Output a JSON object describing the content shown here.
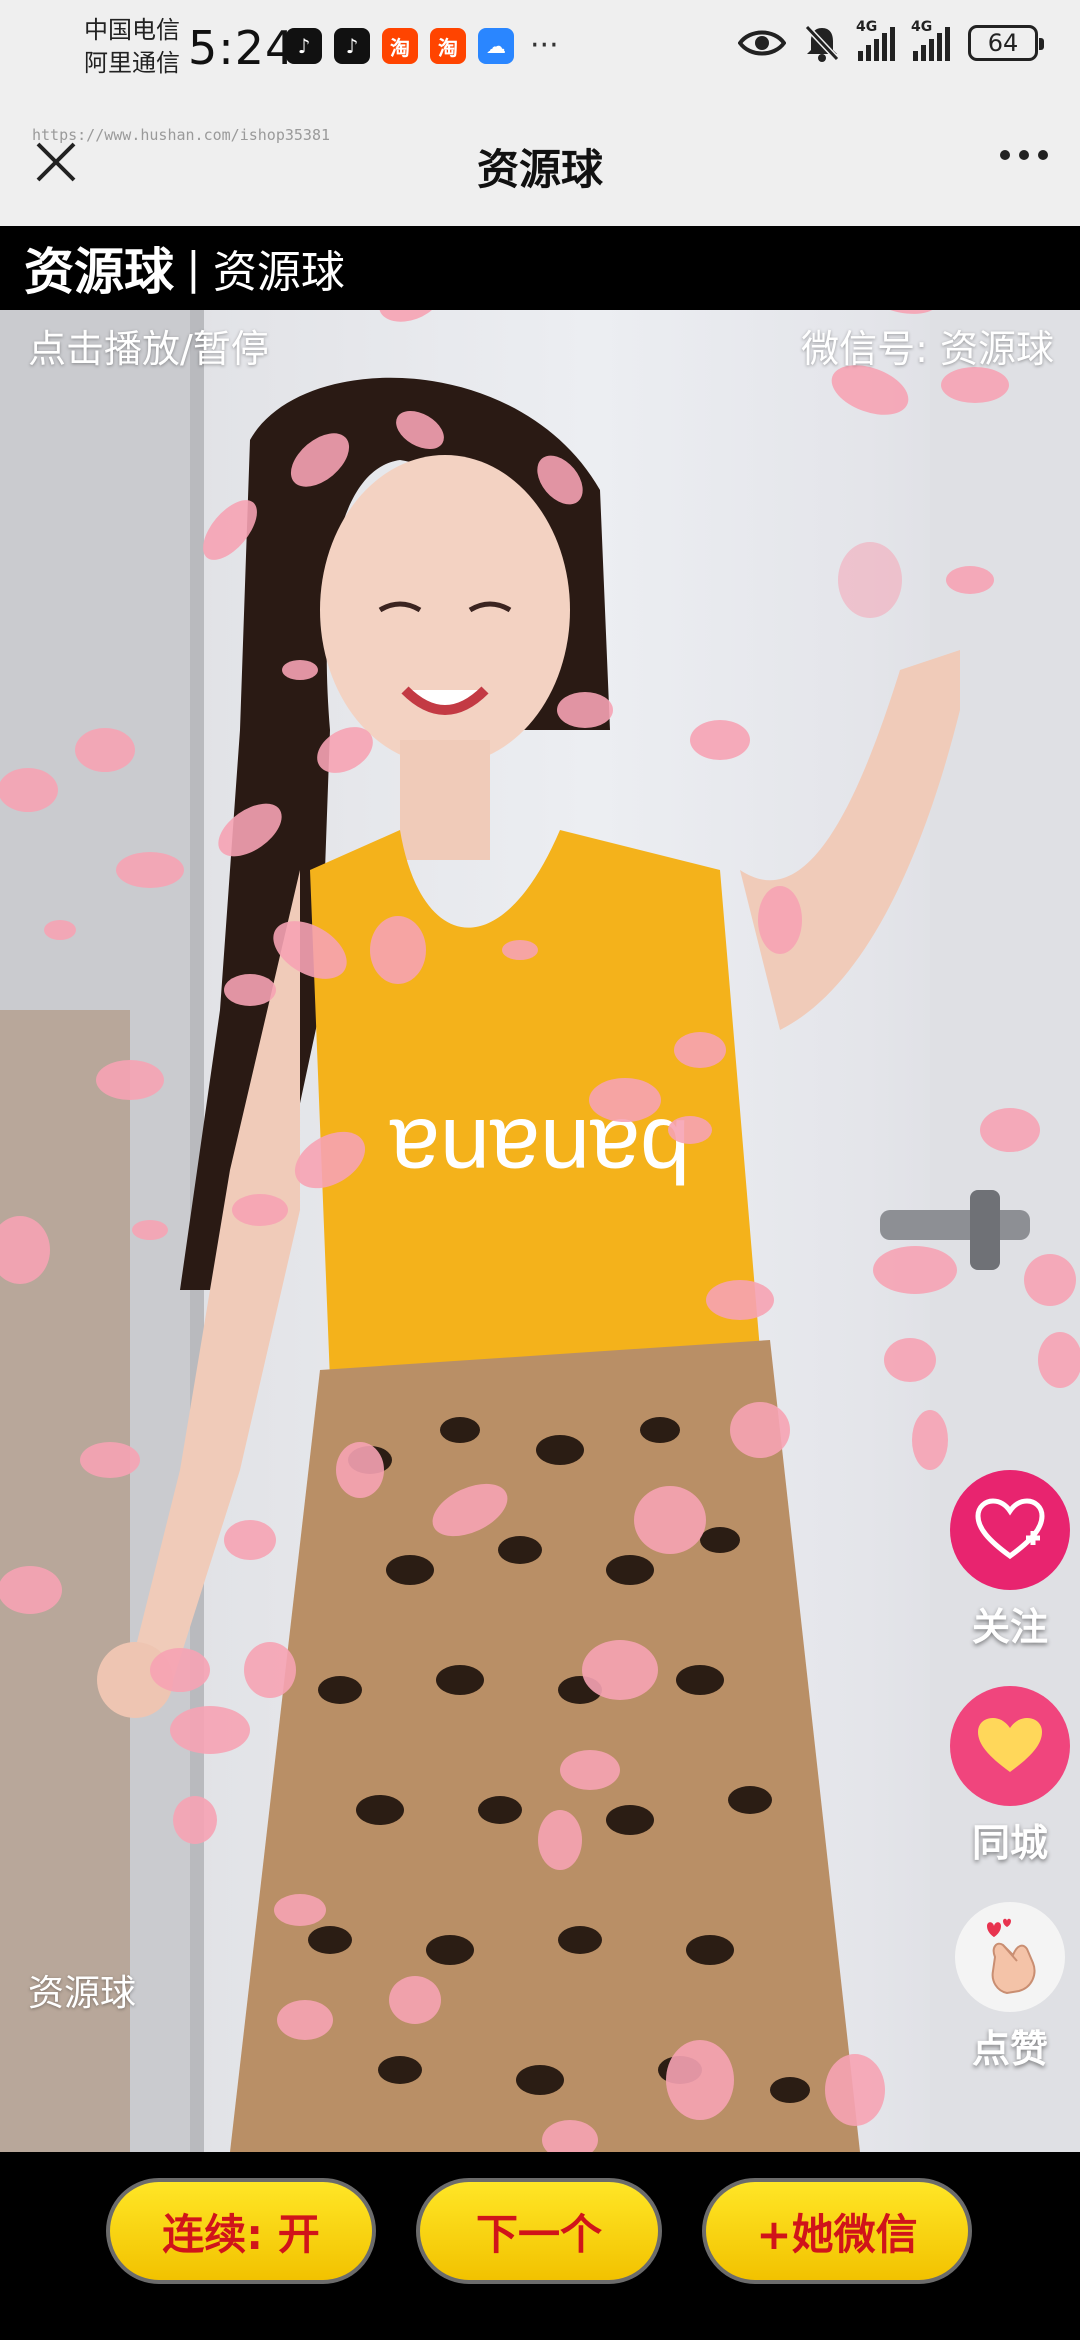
{
  "status_bar": {
    "carrier_1": "中国电信",
    "carrier_2": "阿里通信",
    "time": "5:24",
    "more": "···",
    "network_1": "4G",
    "network_2": "4G",
    "battery": "64"
  },
  "nav": {
    "url": "https://www.hushan.com/ishop35381",
    "title": "资源球"
  },
  "header": {
    "brand": "资源球",
    "separator": "|",
    "subtitle": "资源球"
  },
  "video": {
    "play_hint": "点击播放/暂停",
    "wechat_label": "微信号: 资源球",
    "watermark": "资源球"
  },
  "side_actions": {
    "follow_label": "关注",
    "city_label": "同城",
    "like_label": "点赞"
  },
  "bottom_bar": {
    "continuous_label": "连续: 开",
    "next_label": "下一个",
    "add_wechat_label": "+她微信"
  },
  "colors": {
    "follow_pink": "#e8246f",
    "button_yellow": "#ffe626",
    "button_text_red": "#d0141a"
  }
}
